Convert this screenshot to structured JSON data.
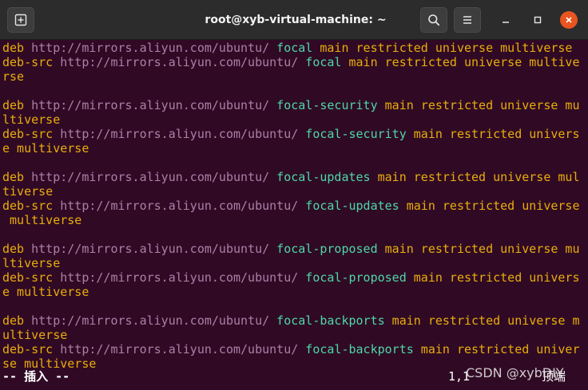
{
  "window": {
    "title": "root@xyb-virtual-machine: ~"
  },
  "icons": {
    "new_tab": "new-tab-icon",
    "search": "search-icon",
    "menu": "hamburger-menu-icon",
    "minimize": "minimize-icon",
    "maximize": "maximize-icon",
    "close": "close-icon"
  },
  "colors": {
    "terminal_bg": "#300a24",
    "keyword": "#e9ad0c",
    "url": "#ad7fa8",
    "suite": "#4fd6a9",
    "close": "#e95420"
  },
  "lines": [
    {
      "segments": [
        {
          "t": "deb",
          "c": "c-keyword"
        },
        {
          "t": " "
        },
        {
          "t": "http://mirrors.aliyun.com/ubuntu/",
          "c": "c-url"
        },
        {
          "t": " "
        },
        {
          "t": "focal",
          "c": "c-suite"
        },
        {
          "t": " "
        },
        {
          "t": "main restricted universe multiverse",
          "c": "c-comp"
        }
      ]
    },
    {
      "segments": [
        {
          "t": "deb-src",
          "c": "c-keyword"
        },
        {
          "t": " "
        },
        {
          "t": "http://mirrors.aliyun.com/ubuntu/",
          "c": "c-url"
        },
        {
          "t": " "
        },
        {
          "t": "focal",
          "c": "c-suite"
        },
        {
          "t": " "
        },
        {
          "t": "main restricted universe multive",
          "c": "c-comp"
        }
      ]
    },
    {
      "segments": [
        {
          "t": "rse",
          "c": "c-comp"
        }
      ]
    },
    {
      "segments": []
    },
    {
      "segments": [
        {
          "t": "deb",
          "c": "c-keyword"
        },
        {
          "t": " "
        },
        {
          "t": "http://mirrors.aliyun.com/ubuntu/",
          "c": "c-url"
        },
        {
          "t": " "
        },
        {
          "t": "focal-security",
          "c": "c-suite"
        },
        {
          "t": " "
        },
        {
          "t": "main restricted universe mu",
          "c": "c-comp"
        }
      ]
    },
    {
      "segments": [
        {
          "t": "ltiverse",
          "c": "c-comp"
        }
      ]
    },
    {
      "segments": [
        {
          "t": "deb-src",
          "c": "c-keyword"
        },
        {
          "t": " "
        },
        {
          "t": "http://mirrors.aliyun.com/ubuntu/",
          "c": "c-url"
        },
        {
          "t": " "
        },
        {
          "t": "focal-security",
          "c": "c-suite"
        },
        {
          "t": " "
        },
        {
          "t": "main restricted univers",
          "c": "c-comp"
        }
      ]
    },
    {
      "segments": [
        {
          "t": "e multiverse",
          "c": "c-comp"
        }
      ]
    },
    {
      "segments": []
    },
    {
      "segments": [
        {
          "t": "deb",
          "c": "c-keyword"
        },
        {
          "t": " "
        },
        {
          "t": "http://mirrors.aliyun.com/ubuntu/",
          "c": "c-url"
        },
        {
          "t": " "
        },
        {
          "t": "focal-updates",
          "c": "c-suite"
        },
        {
          "t": " "
        },
        {
          "t": "main restricted universe mul",
          "c": "c-comp"
        }
      ]
    },
    {
      "segments": [
        {
          "t": "tiverse",
          "c": "c-comp"
        }
      ]
    },
    {
      "segments": [
        {
          "t": "deb-src",
          "c": "c-keyword"
        },
        {
          "t": " "
        },
        {
          "t": "http://mirrors.aliyun.com/ubuntu/",
          "c": "c-url"
        },
        {
          "t": " "
        },
        {
          "t": "focal-updates",
          "c": "c-suite"
        },
        {
          "t": " "
        },
        {
          "t": "main restricted universe",
          "c": "c-comp"
        }
      ]
    },
    {
      "segments": [
        {
          "t": " multiverse",
          "c": "c-comp"
        }
      ]
    },
    {
      "segments": []
    },
    {
      "segments": [
        {
          "t": "deb",
          "c": "c-keyword"
        },
        {
          "t": " "
        },
        {
          "t": "http://mirrors.aliyun.com/ubuntu/",
          "c": "c-url"
        },
        {
          "t": " "
        },
        {
          "t": "focal-proposed",
          "c": "c-suite"
        },
        {
          "t": " "
        },
        {
          "t": "main restricted universe mu",
          "c": "c-comp"
        }
      ]
    },
    {
      "segments": [
        {
          "t": "ltiverse",
          "c": "c-comp"
        }
      ]
    },
    {
      "segments": [
        {
          "t": "deb-src",
          "c": "c-keyword"
        },
        {
          "t": " "
        },
        {
          "t": "http://mirrors.aliyun.com/ubuntu/",
          "c": "c-url"
        },
        {
          "t": " "
        },
        {
          "t": "focal-proposed",
          "c": "c-suite"
        },
        {
          "t": " "
        },
        {
          "t": "main restricted univers",
          "c": "c-comp"
        }
      ]
    },
    {
      "segments": [
        {
          "t": "e multiverse",
          "c": "c-comp"
        }
      ]
    },
    {
      "segments": []
    },
    {
      "segments": [
        {
          "t": "deb",
          "c": "c-keyword"
        },
        {
          "t": " "
        },
        {
          "t": "http://mirrors.aliyun.com/ubuntu/",
          "c": "c-url"
        },
        {
          "t": " "
        },
        {
          "t": "focal-backports",
          "c": "c-suite"
        },
        {
          "t": " "
        },
        {
          "t": "main restricted universe m",
          "c": "c-comp"
        }
      ]
    },
    {
      "segments": [
        {
          "t": "ultiverse",
          "c": "c-comp"
        }
      ]
    },
    {
      "segments": [
        {
          "t": "deb-src",
          "c": "c-keyword"
        },
        {
          "t": " "
        },
        {
          "t": "http://mirrors.aliyun.com/ubuntu/",
          "c": "c-url"
        },
        {
          "t": " "
        },
        {
          "t": "focal-backports",
          "c": "c-suite"
        },
        {
          "t": " "
        },
        {
          "t": "main restricted univer",
          "c": "c-comp"
        }
      ]
    },
    {
      "segments": [
        {
          "t": "se multiverse",
          "c": "c-comp"
        }
      ]
    }
  ],
  "status": {
    "mode": "-- 插入 --",
    "cursor_pos": "1,1",
    "position_label": "顶端"
  },
  "watermark": "CSDN @xybDIY"
}
